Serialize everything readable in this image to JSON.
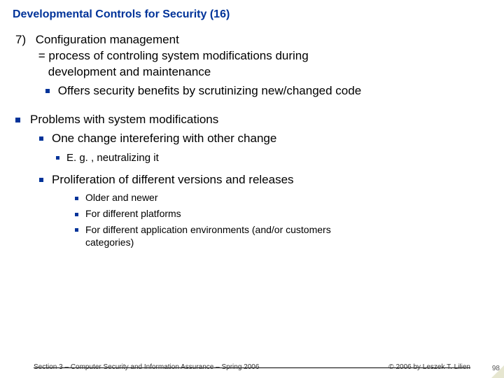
{
  "title": "Developmental Controls for Security (16)",
  "item7": {
    "num": "7)",
    "heading": "Configuration management",
    "def_line1": "= process of controling system modifications during",
    "def_line2": "development and maintenance",
    "bullet1": "Offers security benefits by scrutinizing new/changed code"
  },
  "problems": {
    "heading": "Problems with system modifications",
    "b1": "One change interefering with other change",
    "b1_sub": "E. g. , neutralizing it",
    "b2": "Proliferation of different versions and releases",
    "b2_sub1": "Older and newer",
    "b2_sub2": "For different platforms",
    "b2_sub3a": "For different application environments (and/or customers",
    "b2_sub3b": "categories)"
  },
  "footer_left": "Section 3 – Computer Security and Information Assurance – Spring 2006",
  "footer_right": "© 2006 by Leszek T. Lilien",
  "page_num": "98"
}
